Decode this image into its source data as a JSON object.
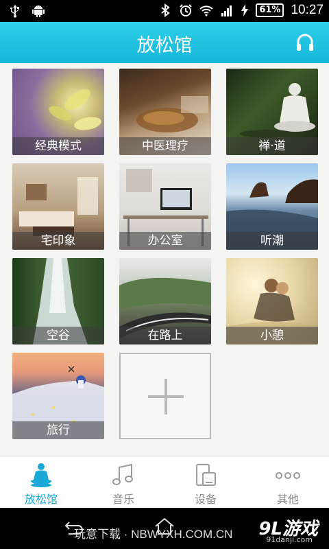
{
  "status_bar": {
    "battery": "61%",
    "time": "10:27"
  },
  "header": {
    "title": "放松馆"
  },
  "tiles": [
    {
      "label": "经典模式"
    },
    {
      "label": "中医理疗"
    },
    {
      "label": "禅·道"
    },
    {
      "label": "宅印象"
    },
    {
      "label": "办公室"
    },
    {
      "label": "听潮"
    },
    {
      "label": "空谷"
    },
    {
      "label": "在路上"
    },
    {
      "label": "小憩"
    },
    {
      "label": "旅行"
    }
  ],
  "tabs": [
    {
      "label": "放松馆",
      "icon": "meditation-icon",
      "active": true
    },
    {
      "label": "音乐",
      "icon": "music-note-icon"
    },
    {
      "label": "设备",
      "icon": "devices-icon"
    },
    {
      "label": "其他",
      "icon": "more-dots-icon"
    }
  ],
  "watermark": {
    "text": "玩意下载 · NBWYXH.COM.CN",
    "brand": "9L游戏",
    "brand_sub": "91danji.com"
  },
  "colors": {
    "header": "#15b6d8",
    "active_tab": "#1ba9d8",
    "inactive_tab": "#8a8a8a"
  }
}
